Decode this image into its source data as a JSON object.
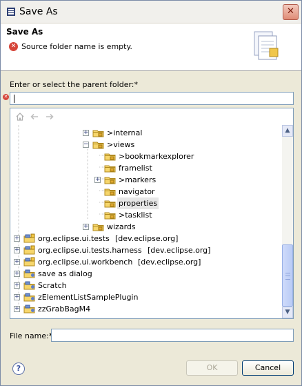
{
  "window": {
    "title": "Save As",
    "close_label": "✕"
  },
  "header": {
    "title": "Save As",
    "error_message": "Source folder name is empty."
  },
  "parent_folder": {
    "label": "Enter or select the parent folder:*",
    "value": ""
  },
  "tree": {
    "rows": [
      {
        "label": ">internal",
        "expander": "+",
        "icon": "folder-package-icon",
        "selected": false
      },
      {
        "label": ">views",
        "expander": "−",
        "icon": "folder-package-icon",
        "selected": false
      },
      {
        "label": ">bookmarkexplorer",
        "expander": "",
        "icon": "folder-package-icon",
        "selected": false
      },
      {
        "label": "framelist",
        "expander": "",
        "icon": "folder-package-icon",
        "selected": false
      },
      {
        "label": ">markers",
        "expander": "+",
        "icon": "folder-package-icon",
        "selected": false
      },
      {
        "label": "navigator",
        "expander": "",
        "icon": "folder-package-icon",
        "selected": false
      },
      {
        "label": "properties",
        "expander": "",
        "icon": "folder-package-icon",
        "selected": true
      },
      {
        "label": ">tasklist",
        "expander": "",
        "icon": "folder-package-icon",
        "selected": false
      },
      {
        "label": "wizards",
        "expander": "+",
        "icon": "folder-package-icon",
        "selected": false
      },
      {
        "label": "org.eclipse.ui.tests",
        "suffix": "[dev.eclipse.org]",
        "expander": "+",
        "icon": "project-cvs-icon",
        "selected": false
      },
      {
        "label": "org.eclipse.ui.tests.harness",
        "suffix": "[dev.eclipse.org]",
        "expander": "+",
        "icon": "project-cvs-icon",
        "selected": false
      },
      {
        "label": "org.eclipse.ui.workbench",
        "suffix": "[dev.eclipse.org]",
        "expander": "+",
        "icon": "project-cvs-icon",
        "selected": false
      },
      {
        "label": "save as dialog",
        "expander": "+",
        "icon": "project-icon",
        "selected": false
      },
      {
        "label": "Scratch",
        "expander": "+",
        "icon": "project-icon",
        "selected": false
      },
      {
        "label": "zElementListSamplePlugin",
        "expander": "+",
        "icon": "project-icon",
        "selected": false
      },
      {
        "label": "zzGrabBagM4",
        "expander": "+",
        "icon": "project-icon",
        "selected": false
      }
    ]
  },
  "file_name": {
    "label": "File name:*",
    "value": ""
  },
  "buttons": {
    "ok": "OK",
    "cancel": "Cancel",
    "help": "?"
  },
  "colors": {
    "selection": "#e6e6e6",
    "error": "#d6453a",
    "dialog_bg": "#ece9d8"
  }
}
